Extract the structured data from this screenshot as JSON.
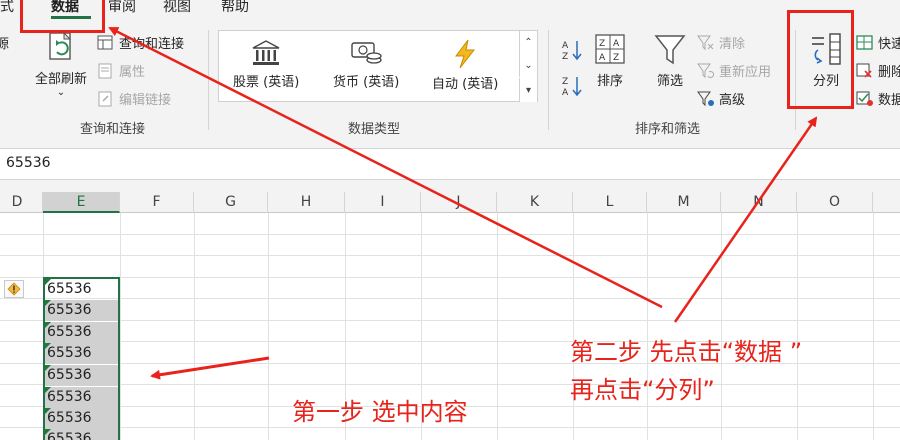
{
  "ribbon": {
    "tabs": [
      {
        "label": "公式"
      },
      {
        "label": "数据",
        "active": true
      },
      {
        "label": "审阅"
      },
      {
        "label": "视图"
      },
      {
        "label": "帮助"
      }
    ],
    "query_group": {
      "refresh_all": "全部刷新",
      "query_connections": "查询和连接",
      "properties": "属性",
      "edit_links": "编辑链接",
      "group_label": "查询和连接",
      "left_partial": "源"
    },
    "datatype_group": {
      "items": [
        {
          "label": "股票 (英语)",
          "icon": "bank-icon"
        },
        {
          "label": "货币 (英语)",
          "icon": "currency-icon"
        },
        {
          "label": "自动 (英语)",
          "icon": "lightning-icon"
        }
      ],
      "group_label": "数据类型"
    },
    "sortfilter_group": {
      "sort": "排序",
      "filter": "筛选",
      "clear": "清除",
      "reapply": "重新应用",
      "advanced": "高级",
      "group_label": "排序和筛选"
    },
    "datatools_group": {
      "text_to_columns": "分列",
      "flash_fill": "快速",
      "remove_duplicates": "删除",
      "data_validation": "数据"
    }
  },
  "formula_bar": {
    "value": "65536"
  },
  "grid": {
    "columns": [
      "D",
      "E",
      "F",
      "G",
      "H",
      "I",
      "J",
      "K",
      "L",
      "M",
      "N",
      "O"
    ],
    "selected_column": "E",
    "cells": [
      "65536",
      "65536",
      "65536",
      "65536",
      "65536",
      "65536",
      "65536",
      "65536"
    ]
  },
  "annotations": {
    "step1": "第一步 选中内容",
    "step2_line1": "第二步 先点击“数据 ”",
    "step2_line2": "再点击“分列”",
    "color": "#e8231b"
  },
  "colors": {
    "accent": "#217346",
    "annotation": "#e8231b"
  }
}
